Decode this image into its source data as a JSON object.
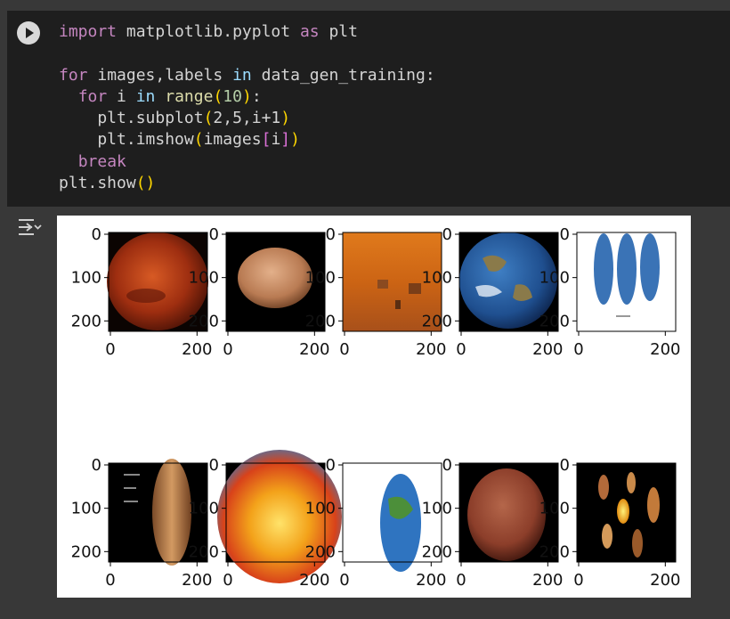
{
  "code_cell": {
    "line1": {
      "kw_import": "import",
      "module": " matplotlib.pyplot ",
      "kw_as": "as",
      "alias": " plt"
    },
    "line3": {
      "kw_for": "for",
      "vars": " images,labels ",
      "kw_in": "in",
      "iter": " data_gen_training:"
    },
    "line4": {
      "indent": "  ",
      "kw_for": "for",
      "var": " i ",
      "kw_in": "in",
      "sp": " ",
      "fn_range": "range",
      "open": "(",
      "num": "10",
      "close": ")",
      "colon": ":"
    },
    "line5": {
      "text": "    plt.subplot",
      "open": "(",
      "args": "2,5,i+1",
      "close": ")"
    },
    "line6": {
      "text": "    plt.imshow",
      "open": "(",
      "arg": "images",
      "bopen": "[",
      "idx": "i",
      "bclose": "]",
      "close": ")"
    },
    "line7": {
      "indent": "  ",
      "kw_break": "break"
    },
    "line8": {
      "text": "plt.show",
      "open": "(",
      "close": ")"
    }
  },
  "icons": {
    "run": "play-icon",
    "output_toggle": "output-expand-icon"
  },
  "output_figure": {
    "subplots": [
      {
        "content": "red planet Mars close-up"
      },
      {
        "content": "Mars disc on black"
      },
      {
        "content": "orange Mars surface scene"
      },
      {
        "content": "Earth globe"
      },
      {
        "content": "three Earth globes"
      },
      {
        "content": "Mars on black with annotations"
      },
      {
        "content": "Earth interior layers"
      },
      {
        "content": "Earth globe on white"
      },
      {
        "content": "Mars on black"
      },
      {
        "content": "solar system diagram"
      }
    ],
    "y_ticks": [
      "0",
      "100",
      "200"
    ],
    "x_ticks": [
      "0",
      "200"
    ]
  },
  "colors": {
    "page_bg": "#383838",
    "cell_bg": "#1e1e1e",
    "keyword": "#c586c0",
    "paren": "#ffd700"
  }
}
